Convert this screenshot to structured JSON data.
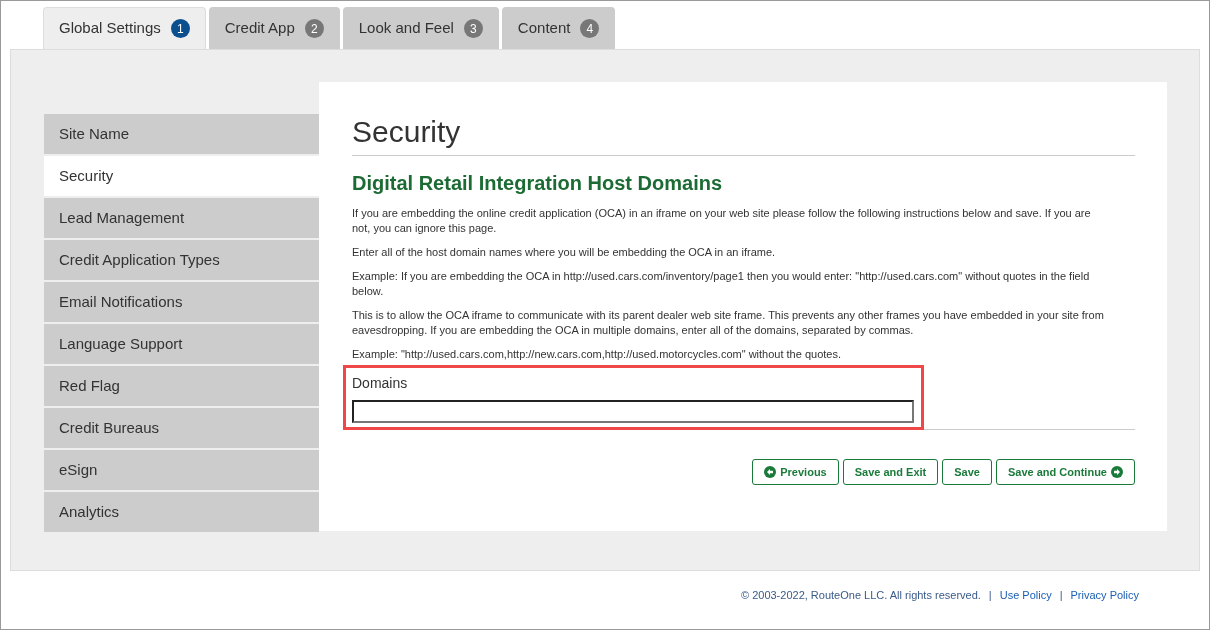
{
  "tabs": [
    {
      "label": "Global Settings",
      "number": "1",
      "selected": true
    },
    {
      "label": "Credit App",
      "number": "2",
      "selected": false
    },
    {
      "label": "Look and Feel",
      "number": "3",
      "selected": false
    },
    {
      "label": "Content",
      "number": "4",
      "selected": false
    }
  ],
  "sidebar": {
    "items": [
      {
        "label": "Site Name",
        "selected": false
      },
      {
        "label": "Security",
        "selected": true
      },
      {
        "label": "Lead Management",
        "selected": false
      },
      {
        "label": "Credit Application Types",
        "selected": false
      },
      {
        "label": "Email Notifications",
        "selected": false
      },
      {
        "label": "Language Support",
        "selected": false
      },
      {
        "label": "Red Flag",
        "selected": false
      },
      {
        "label": "Credit Bureaus",
        "selected": false
      },
      {
        "label": "eSign",
        "selected": false
      },
      {
        "label": "Analytics",
        "selected": false
      }
    ]
  },
  "page_title": "Security",
  "section_title": "Digital Retail Integration Host Domains",
  "paragraphs": [
    "If you are embedding the online credit application (OCA) in an iframe on your web site please follow the following instructions below and save. If you are not, you can ignore this page.",
    "Enter all of the host domain names where you will be embedding the OCA in an iframe.",
    "Example: If you are embedding the OCA in http://used.cars.com/inventory/page1 then you would enter: \"http://used.cars.com\" without quotes in the field below.",
    "This is to allow the OCA iframe to communicate with its parent dealer web site frame. This prevents any other frames you have embedded in your site from eavesdropping. If you are embedding the OCA in multiple domains, enter all of the domains, separated by commas.",
    "Example: \"http://used.cars.com,http://new.cars.com,http://used.motorcycles.com\" without the quotes."
  ],
  "domains_field": {
    "label": "Domains",
    "highlighted": true
  },
  "buttons": [
    {
      "label": "Previous",
      "kind": "back"
    },
    {
      "label": "Save and Exit",
      "kind": "plain"
    },
    {
      "label": "Save",
      "kind": "plain"
    },
    {
      "label": "Save and Continue",
      "kind": "next"
    }
  ],
  "footer": {
    "copyright": "© 2003-2022, RouteOne LLC. All rights reserved.",
    "separators": [
      "|",
      "|"
    ],
    "links": [
      "Use Policy",
      "Privacy Policy"
    ]
  }
}
